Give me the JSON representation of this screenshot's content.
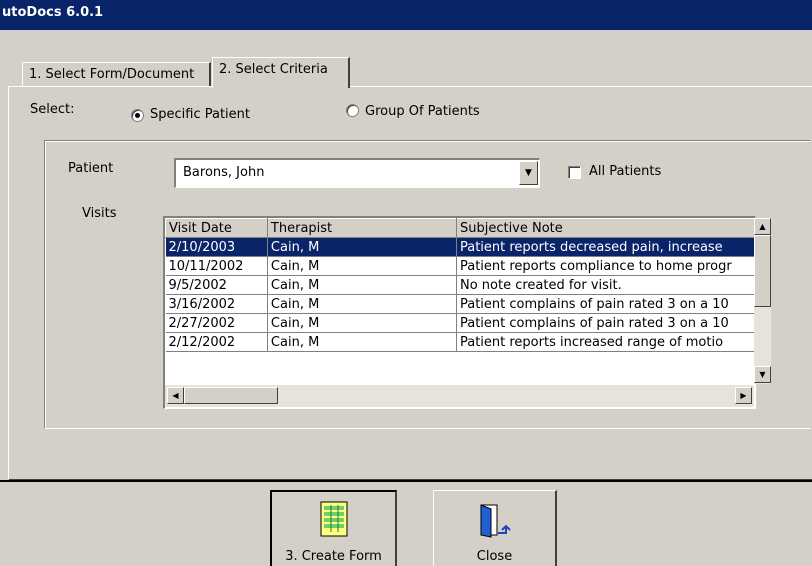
{
  "window": {
    "title": "utoDocs 6.0.1"
  },
  "tabs": [
    {
      "label": "1. Select Form/Document",
      "active": false
    },
    {
      "label": "2. Select Criteria",
      "active": true
    }
  ],
  "select": {
    "label": "Select:",
    "options": [
      {
        "label": "Specific Patient",
        "checked": true
      },
      {
        "label": "Group Of Patients",
        "checked": false
      }
    ]
  },
  "patient": {
    "label": "Patient",
    "value": "Barons, John",
    "all_patients_label": "All Patients",
    "all_patients_checked": false
  },
  "visits": {
    "label": "Visits",
    "columns": [
      "Visit Date",
      "Therapist",
      "Subjective Note"
    ],
    "rows": [
      [
        "2/10/2003",
        "Cain, M",
        "Patient reports decreased pain,  increase"
      ],
      [
        "10/11/2002",
        "Cain, M",
        "Patient reports compliance to home progr"
      ],
      [
        "9/5/2002",
        "Cain, M",
        "No note created for visit."
      ],
      [
        "3/16/2002",
        "Cain, M",
        "Patient complains of pain rated 3 on a 10"
      ],
      [
        "2/27/2002",
        "Cain, M",
        " Patient complains of pain rated 3 on a 10"
      ],
      [
        "2/12/2002",
        "Cain, M",
        "Patient reports increased  range of motio"
      ]
    ],
    "selected_row": 0
  },
  "actions": {
    "create_label": "3. Create Form",
    "close_label": "Close"
  },
  "icons": {
    "create": "form-document-icon",
    "close": "door-exit-icon",
    "dropdown": "chevron-down-icon"
  },
  "colors": {
    "titlebar": "#0a246a",
    "selection": "#0a246a",
    "face": "#d4d0c8"
  }
}
